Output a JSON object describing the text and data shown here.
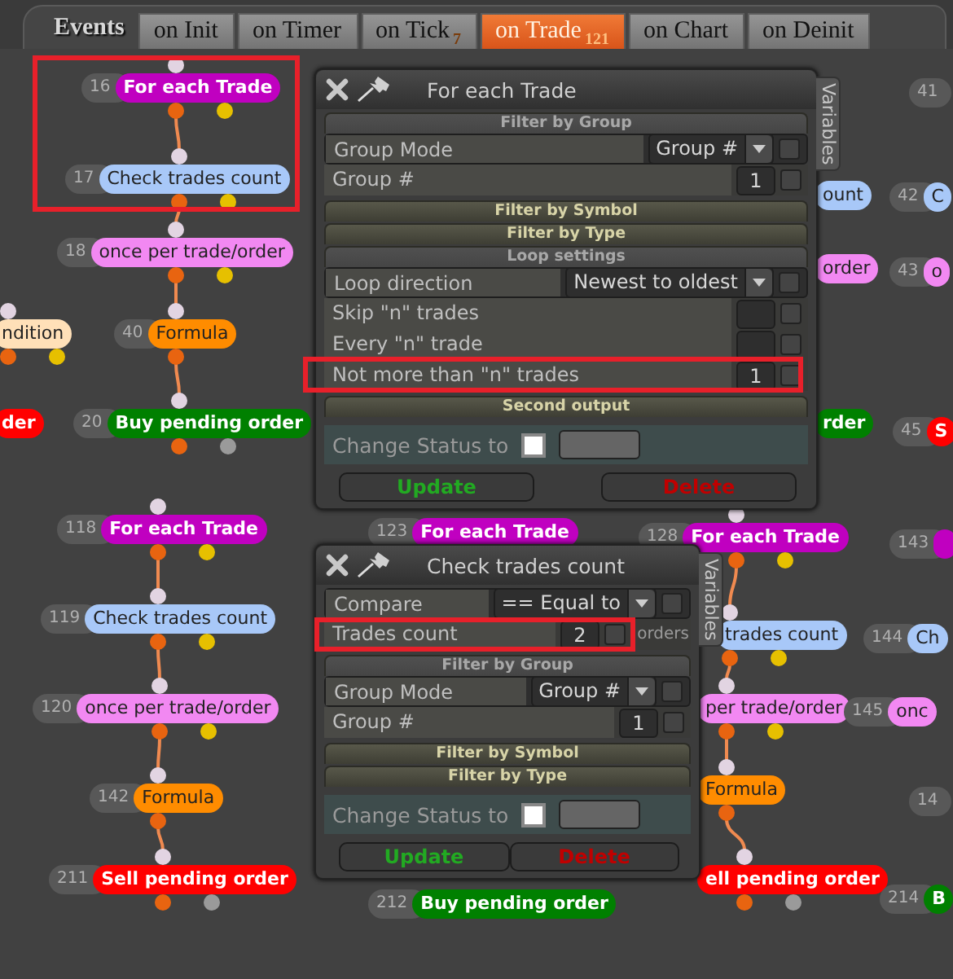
{
  "events_label": "Events",
  "tabs": [
    {
      "label": "on Init",
      "selected": false
    },
    {
      "label": "on Timer",
      "selected": false
    },
    {
      "label": "on Tick",
      "count": "7",
      "selected": false
    },
    {
      "label": "on Trade",
      "count": "121",
      "selected": true
    },
    {
      "label": "on Chart",
      "selected": false
    },
    {
      "label": "on Deinit",
      "selected": false
    }
  ],
  "nodes": [
    {
      "number": "16",
      "label": "For each Trade",
      "color": "#c000c0",
      "kind": "condition"
    },
    {
      "number": "17",
      "label": "Check trades count",
      "color": "#a8c8f8",
      "kind": "condition"
    },
    {
      "number": "18",
      "label": "once per trade/order",
      "color": "#f288f2",
      "kind": "condition"
    },
    {
      "label": "ndition",
      "color": "#ffe0b8",
      "kind": "condition"
    },
    {
      "number": "40",
      "label": "Formula",
      "color": "#ff8c00",
      "kind": "formula"
    },
    {
      "label": "der",
      "color": "#ff0000",
      "kind": "fragment"
    },
    {
      "number": "20",
      "label": "Buy pending order",
      "color": "#008000",
      "kind": "action"
    },
    {
      "number": "118",
      "label": "For each Trade",
      "color": "#c000c0",
      "kind": "condition"
    },
    {
      "number": "119",
      "label": "Check trades count",
      "color": "#a8c8f8",
      "kind": "condition"
    },
    {
      "number": "120",
      "label": "once per trade/order",
      "color": "#f288f2",
      "kind": "condition"
    },
    {
      "number": "142",
      "label": "Formula",
      "color": "#ff8c00",
      "kind": "formula"
    },
    {
      "number": "211",
      "label": "Sell pending order",
      "color": "#ff0000",
      "kind": "action"
    },
    {
      "number": "123",
      "label": "For each Trade",
      "color": "#c000c0",
      "kind": "fragment"
    },
    {
      "number": "212",
      "label": "Buy pending order",
      "color": "#008000",
      "kind": "fragment"
    },
    {
      "label": "ount",
      "color": "#a8c8f8",
      "kind": "fragment"
    },
    {
      "label": "order",
      "color": "#f288f2",
      "kind": "fragment"
    },
    {
      "label": "rder",
      "color": "#008000",
      "kind": "fragment"
    },
    {
      "number": "128",
      "label": "For each Trade",
      "color": "#c000c0",
      "kind": "condition"
    },
    {
      "label": "trades count",
      "color": "#a8c8f8",
      "kind": "condition"
    },
    {
      "label": "per trade/order",
      "color": "#f288f2",
      "kind": "condition"
    },
    {
      "label": "Formula",
      "color": "#ff8c00",
      "kind": "formula"
    },
    {
      "label": "ell pending order",
      "color": "#ff0000",
      "kind": "action"
    },
    {
      "number": "41",
      "kind": "fragment"
    },
    {
      "number": "42",
      "label": "C",
      "color": "#a8c8f8",
      "kind": "fragment"
    },
    {
      "number": "43",
      "label": "o",
      "color": "#f288f2",
      "kind": "fragment"
    },
    {
      "number": "45",
      "label": "S",
      "color": "#ff0000",
      "kind": "fragment"
    },
    {
      "number": "143",
      "color": "#c000c0",
      "kind": "fragment"
    },
    {
      "number": "144",
      "label": "Ch",
      "color": "#a8c8f8",
      "kind": "fragment"
    },
    {
      "number": "145",
      "label": "onc",
      "color": "#f288f2",
      "kind": "fragment"
    },
    {
      "number": "14",
      "kind": "fragment"
    },
    {
      "number": "214",
      "label": "B",
      "color": "#008000",
      "kind": "fragment"
    }
  ],
  "dialogs": [
    {
      "title": "For each Trade",
      "side_tab": "Variables",
      "items": [
        {
          "kind": "header",
          "title": "Filter by Group",
          "expanded": true
        },
        {
          "kind": "dropdown",
          "label": "Group Mode",
          "value": "Group #",
          "checked": false
        },
        {
          "kind": "input",
          "label": "Group #",
          "value": "1",
          "checked": false
        },
        {
          "kind": "header",
          "title": "Filter by Symbol",
          "expanded": false
        },
        {
          "kind": "header",
          "title": "Filter by Type",
          "expanded": false
        },
        {
          "kind": "header",
          "title": "Loop settings",
          "expanded": true
        },
        {
          "kind": "dropdown",
          "label": "Loop direction",
          "value": "Newest to oldest",
          "checked": false
        },
        {
          "kind": "input",
          "label": "Skip \"n\" trades",
          "checked": false
        },
        {
          "kind": "input",
          "label": "Every \"n\" trade",
          "checked": false
        },
        {
          "kind": "input",
          "label": "Not more than \"n\" trades",
          "value": "1",
          "checked": false
        },
        {
          "kind": "header",
          "title": "Second output",
          "expanded": false
        },
        {
          "kind": "status",
          "label": "Change Status to",
          "checked": false
        }
      ],
      "buttons": [
        {
          "label": "Update",
          "kind": "update"
        },
        {
          "label": "Delete",
          "kind": "delete"
        }
      ]
    },
    {
      "title": "Check trades count",
      "side_tab": "Variables",
      "items": [
        {
          "kind": "dropdown",
          "label": "Compare",
          "value": "== Equal to",
          "checked": false
        },
        {
          "kind": "input",
          "label": "Trades count",
          "value": "2",
          "suffix": "orders",
          "checked": false
        },
        {
          "kind": "header",
          "title": "Filter by Group",
          "expanded": true
        },
        {
          "kind": "dropdown",
          "label": "Group Mode",
          "value": "Group #",
          "checked": false
        },
        {
          "kind": "input",
          "label": "Group #",
          "value": "1",
          "checked": false
        },
        {
          "kind": "header",
          "title": "Filter by Symbol",
          "expanded": false
        },
        {
          "kind": "header",
          "title": "Filter by Type",
          "expanded": false
        },
        {
          "kind": "status",
          "label": "Change Status to",
          "checked": false
        }
      ],
      "buttons": [
        {
          "label": "Update",
          "kind": "update"
        },
        {
          "label": "Delete",
          "kind": "delete"
        }
      ]
    }
  ]
}
